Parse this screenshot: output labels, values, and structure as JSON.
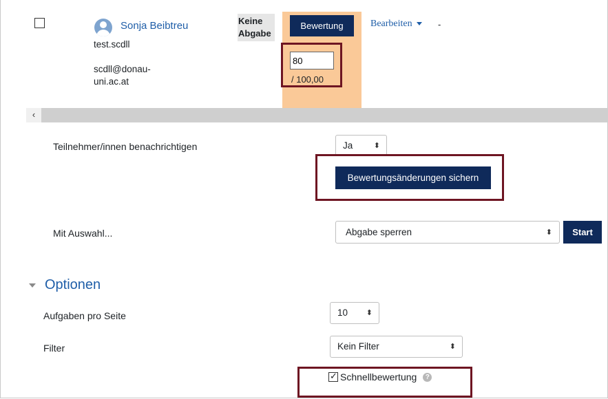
{
  "user": {
    "name": "Sonja Beibtreu",
    "username": "test.scdll",
    "email_line1": "scdll@donau-",
    "email_line2": "uni.ac.at"
  },
  "submission": {
    "status_line1": "Keine",
    "status_line2": "Abgabe",
    "grade_button": "Bewertung",
    "grade_value": "80",
    "grade_max": "/ 100,00",
    "edit_menu": "Bearbeiten",
    "dash": "-"
  },
  "scroll": {
    "left_arrow": "‹"
  },
  "notify": {
    "label": "Teilnehmer/innen benachrichtigen",
    "value": "Ja",
    "arrow": "⬍",
    "save_button": "Bewertungsänderungen sichern"
  },
  "bulk": {
    "label": "Mit Auswahl...",
    "value": "Abgabe sperren",
    "arrow": "⬍",
    "start_button": "Start"
  },
  "options": {
    "title": "Optionen",
    "per_page_label": "Aufgaben pro Seite",
    "per_page_value": "10",
    "filter_label": "Filter",
    "filter_value": "Kein Filter",
    "arrow": "⬍",
    "quick_grading_label": "Schnellbewertung",
    "quick_grading_checked": true,
    "check_mark": "✓",
    "help_icon_text": "?"
  },
  "colors": {
    "accent_link": "#1f5ea8",
    "dark_button": "#0f2a5a",
    "highlight_column": "#fac998",
    "annotation_box": "#6e1522"
  }
}
